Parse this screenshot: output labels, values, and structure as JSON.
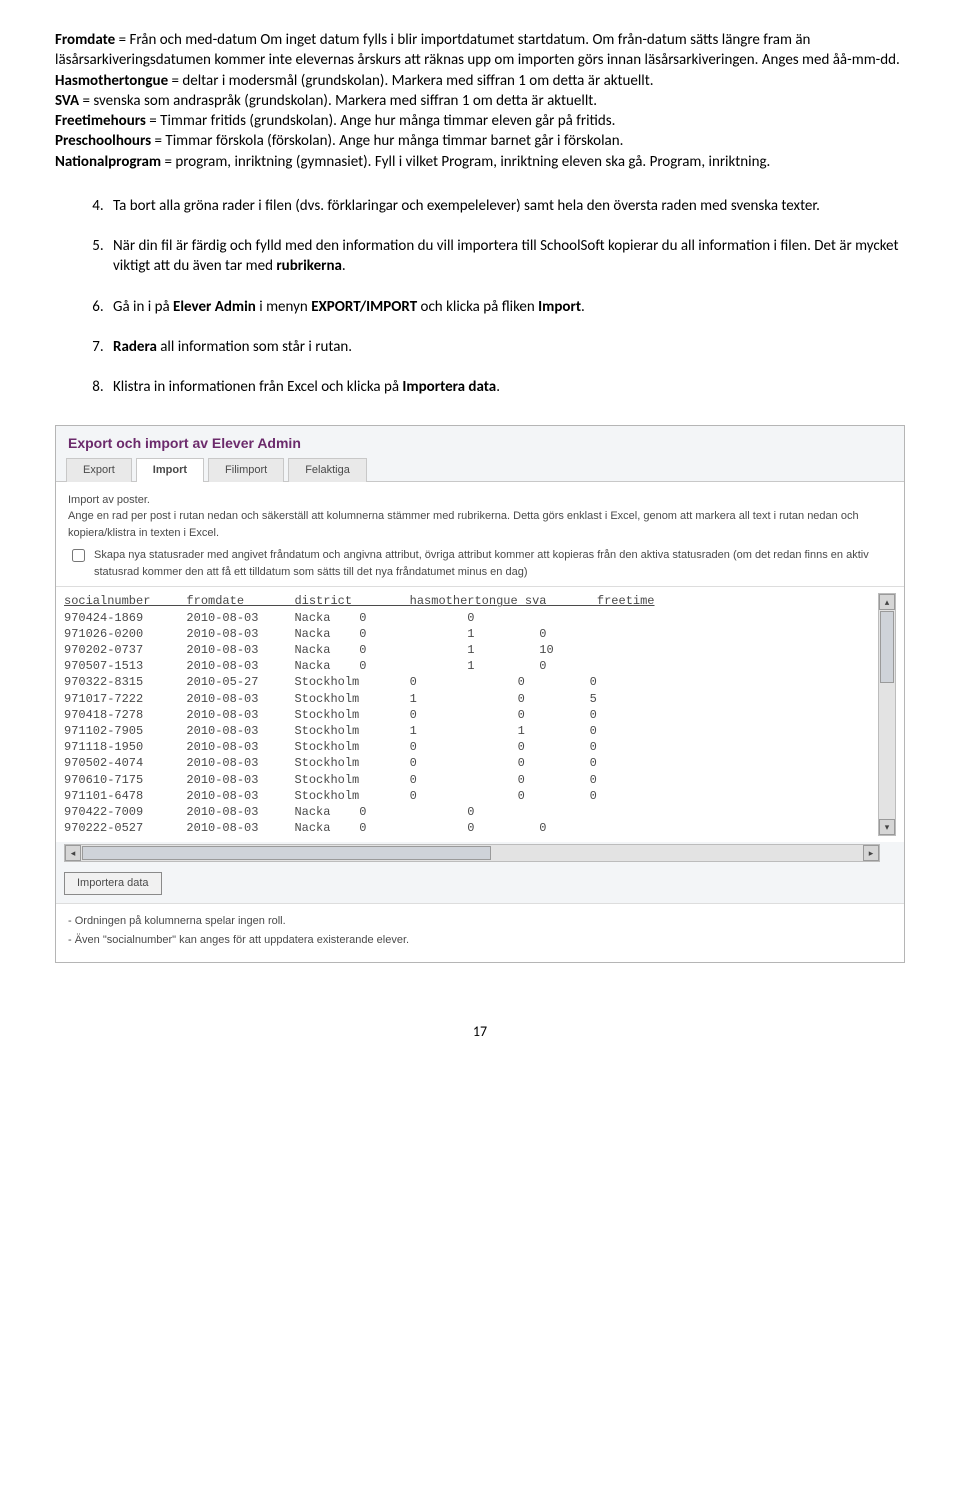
{
  "para": {
    "p1a": "Fromdate",
    "p1b": " = Från och med-datum Om inget datum fylls i blir importdatumet startdatum. Om från-datum sätts längre fram än läsårsarkiveringsdatumen kommer inte elevernas årskurs att räknas upp om importen görs innan läsårsarkiveringen. Anges med åå-mm-dd.",
    "p2a": "Hasmothertongue",
    "p2b": " = deltar i modersmål (grundskolan). Markera med siffran 1 om detta är aktuellt.",
    "p3a": "SVA",
    "p3b": " = svenska som andraspråk (grundskolan). Markera med siffran 1 om detta är aktuellt.",
    "p4a": "Freetimehours",
    "p4b": " = Timmar fritids (grundskolan). Ange hur många timmar eleven går på fritids.",
    "p5a": "Preschoolhours",
    "p5b": " = Timmar förskola (förskolan). Ange hur många timmar barnet går i förskolan.",
    "p6a": "Nationalprogram",
    "p6b": " = program, inriktning (gymnasiet). Fyll i vilket Program, inriktning eleven ska gå. Program, inriktning."
  },
  "steps": {
    "s4": "Ta bort alla gröna rader i filen (dvs. förklaringar och exempelelever) samt hela den översta raden med svenska texter.",
    "s5a": "När din fil är färdig och fylld med den information du vill importera till SchoolSoft kopierar du all information i filen. Det är mycket viktigt att du även tar med ",
    "s5b": "rubrikerna",
    "s5c": ".",
    "s6a": "Gå in i på ",
    "s6b": "Elever Admin",
    "s6c": " i menyn ",
    "s6d": "EXPORT/IMPORT",
    "s6e": " och klicka på fliken ",
    "s6f": "Import",
    "s6g": ".",
    "s7a": "Radera",
    "s7b": " all information som står i rutan.",
    "s8a": "Klistra in informationen från Excel och klicka på ",
    "s8b": "Importera data",
    "s8c": "."
  },
  "app": {
    "title": "Export och import av Elever Admin",
    "tabs": {
      "export": "Export",
      "import": "Import",
      "filimport": "Filimport",
      "felaktiga": "Felaktiga"
    },
    "info1": "Import av poster.",
    "info2": "Ange en rad per post i rutan nedan och säkerställ att kolumnerna stämmer med rubrikerna. Detta görs enklast i Excel, genom att markera all text i rutan nedan och kopiera/klistra in texten i Excel.",
    "cb_text": "Skapa nya statusrader med angivet fråndatum och angivna attribut, övriga attribut kommer att kopieras från den aktiva statusraden (om det redan finns en aktiv statusrad kommer den att få ett tilldatum som sätts till det nya fråndatumet minus en dag)",
    "header_line": "socialnumber     fromdate       district        hasmothertongue sva       freetime",
    "rows": [
      "970424-1869      2010-08-03     Nacka    0              0",
      "971026-0200      2010-08-03     Nacka    0              1         0",
      "970202-0737      2010-08-03     Nacka    0              1         10",
      "970507-1513      2010-08-03     Nacka    0              1         0",
      "970322-8315      2010-05-27     Stockholm       0              0         0",
      "971017-7222      2010-08-03     Stockholm       1              0         5",
      "970418-7278      2010-08-03     Stockholm       0              0         0",
      "971102-7905      2010-08-03     Stockholm       1              1         0",
      "971118-1950      2010-08-03     Stockholm       0              0         0",
      "970502-4074      2010-08-03     Stockholm       0              0         0",
      "970610-7175      2010-08-03     Stockholm       0              0         0",
      "971101-6478      2010-08-03     Stockholm       0              0         0",
      "970422-7009      2010-08-03     Nacka    0              0",
      "970222-0527      2010-08-03     Nacka    0              0         0"
    ],
    "button": "Importera data",
    "note1": "-  Ordningen på kolumnerna spelar ingen roll.",
    "note2": "-  Även \"socialnumber\" kan anges för att uppdatera existerande elever."
  },
  "page_number": "17"
}
